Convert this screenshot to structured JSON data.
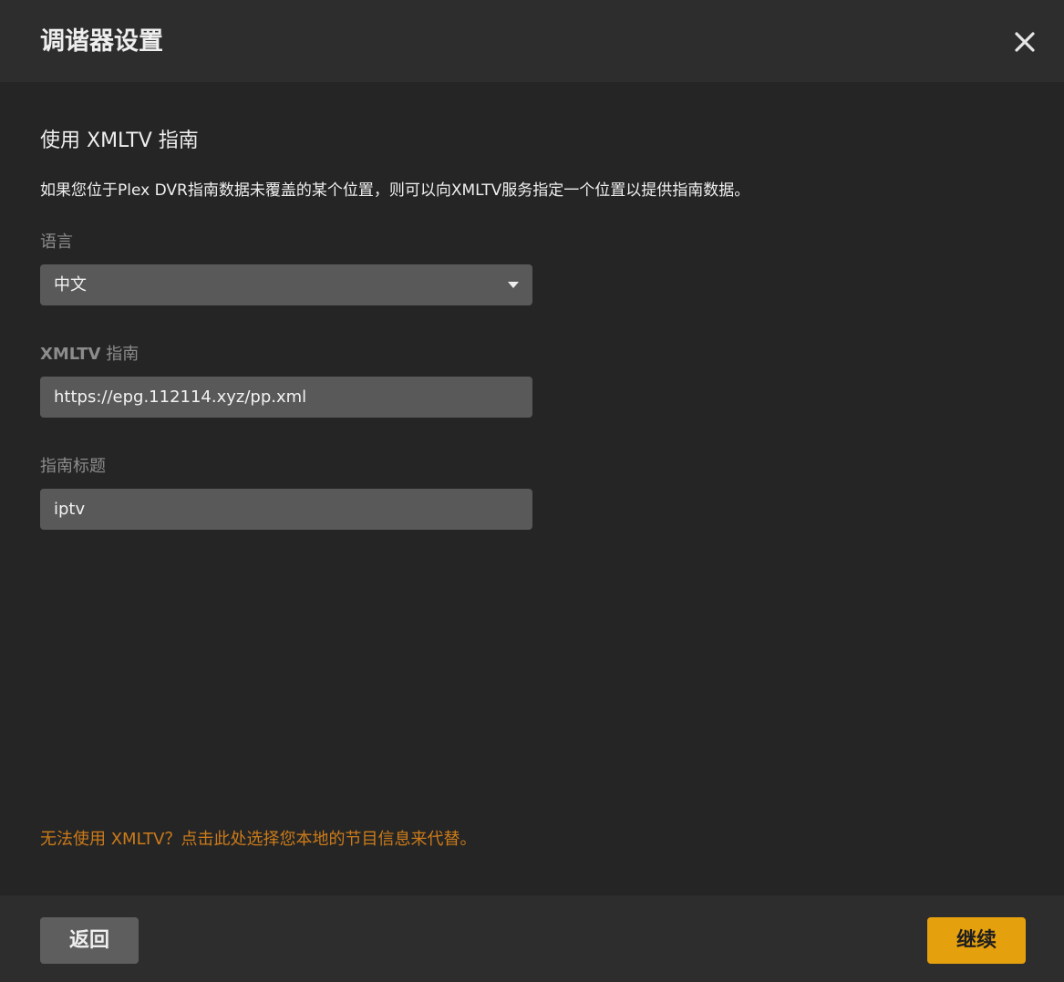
{
  "header": {
    "title": "调谐器设置",
    "close_icon": "close-icon"
  },
  "section": {
    "title": "使用 XMLTV 指南",
    "description": "如果您位于Plex DVR指南数据未覆盖的某个位置，则可以向XMLTV服务指定一个位置以提供指南数据。"
  },
  "language": {
    "label": "语言",
    "selected": "中文"
  },
  "xmltv": {
    "label_strong": "XMLTV",
    "label_rest": " 指南",
    "value": "https://epg.112114.xyz/pp.xml"
  },
  "guide_title": {
    "label": "指南标题",
    "value": "iptv"
  },
  "alt_link": "无法使用 XMLTV？点击此处选择您本地的节目信息来代替。",
  "footer": {
    "back_label": "返回",
    "continue_label": "继续"
  },
  "colors": {
    "accent": "#e5a00d",
    "link": "#cc7b19",
    "background": "#252525",
    "header_bg": "#2d2d2d",
    "field_bg": "#595959"
  }
}
